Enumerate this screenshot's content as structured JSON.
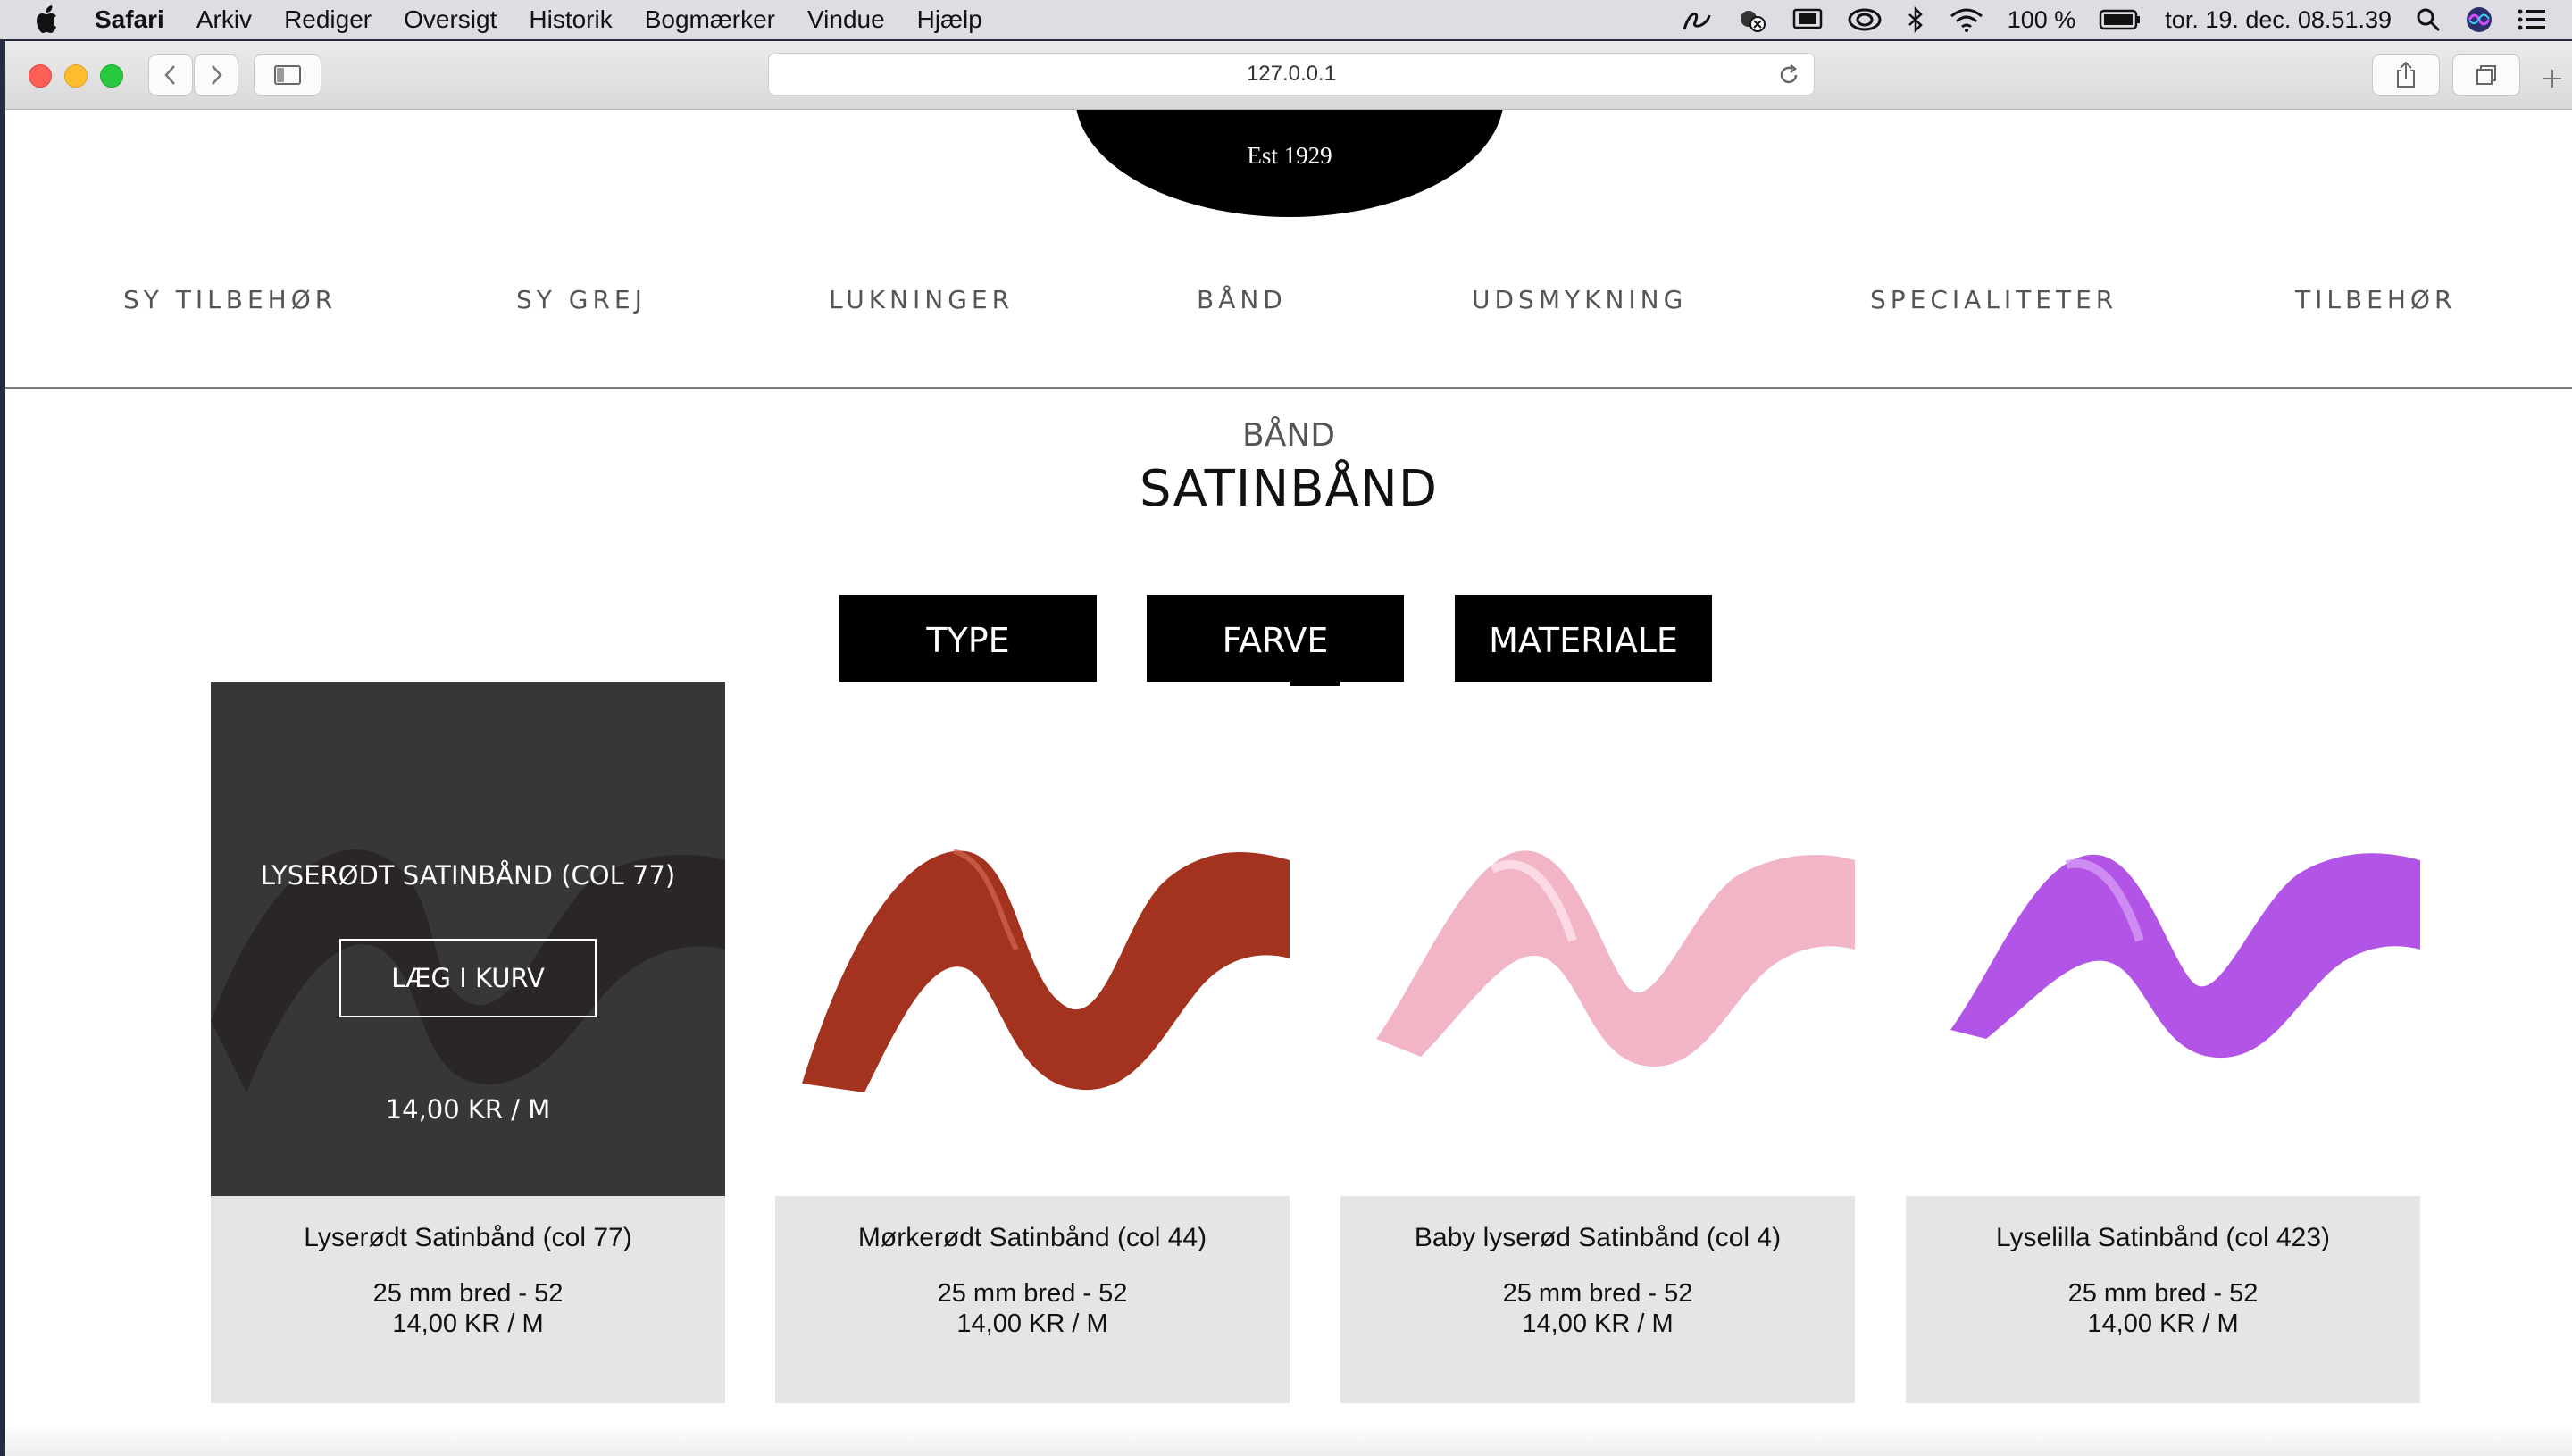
{
  "menubar": {
    "items": [
      "Safari",
      "Arkiv",
      "Rediger",
      "Oversigt",
      "Historik",
      "Bogmærker",
      "Vindue",
      "Hjælp"
    ],
    "battery": "100 %",
    "clock": "tor. 19. dec.  08.51.39"
  },
  "browser": {
    "url": "127.0.0.1"
  },
  "site": {
    "logo_text": "Est 1929",
    "nav": [
      "SY TILBEHØR",
      "SY GREJ",
      "LUKNINGER",
      "BÅND",
      "UDSMYKNING",
      "SPECIALITETER",
      "TILBEHØR"
    ],
    "breadcrumb": "BÅND",
    "title": "SATINBÅND",
    "filters": [
      "TYPE",
      "FARVE",
      "MATERIALE"
    ]
  },
  "products": [
    {
      "name": "Lyserødt Satinbånd (col 77)",
      "width_line": "25 mm bred - 52",
      "price_line": "14,00 KR / M",
      "hover": {
        "name": "LYSERØDT SATINBÅND (COL 77)",
        "button": "LÆG I KURV",
        "price": "14,00 KR / M"
      },
      "ribbon_color": "#4a1a1e"
    },
    {
      "name": "Mørkerødt Satinbånd (col 44)",
      "width_line": "25 mm bred - 52",
      "price_line": "14,00 KR / M",
      "ribbon_color": "#a3321f"
    },
    {
      "name": "Baby lyserød Satinbånd (col 4)",
      "width_line": "25 mm bred - 52",
      "price_line": "14,00 KR / M",
      "ribbon_color": "#f2b5c6"
    },
    {
      "name": "Lyselilla Satinbånd (col 423)",
      "width_line": "25 mm bred - 52",
      "price_line": "14,00 KR / M",
      "ribbon_color": "#b254e6"
    }
  ]
}
